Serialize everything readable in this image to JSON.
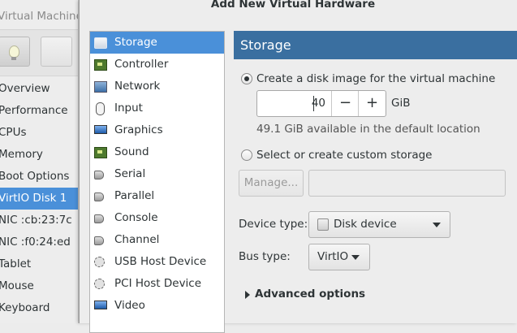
{
  "background_window": {
    "title": "Virtual Machine",
    "items": [
      {
        "label": "Overview"
      },
      {
        "label": "Performance"
      },
      {
        "label": "CPUs"
      },
      {
        "label": "Memory"
      },
      {
        "label": "Boot Options"
      },
      {
        "label": "VirtIO Disk 1",
        "selected": true
      },
      {
        "label": "NIC :cb:23:7c"
      },
      {
        "label": "NIC :f0:24:ed"
      },
      {
        "label": "Tablet"
      },
      {
        "label": "Mouse"
      },
      {
        "label": "Keyboard"
      }
    ]
  },
  "dialog": {
    "title": "Add New Virtual Hardware",
    "hardware_list": [
      {
        "label": "Storage",
        "icon": "disk-icon",
        "selected": true
      },
      {
        "label": "Controller",
        "icon": "chip-icon"
      },
      {
        "label": "Network",
        "icon": "network-icon"
      },
      {
        "label": "Input",
        "icon": "mouse-icon"
      },
      {
        "label": "Graphics",
        "icon": "monitor-icon"
      },
      {
        "label": "Sound",
        "icon": "sound-card-icon"
      },
      {
        "label": "Serial",
        "icon": "plug-icon"
      },
      {
        "label": "Parallel",
        "icon": "plug-icon"
      },
      {
        "label": "Console",
        "icon": "plug-icon"
      },
      {
        "label": "Channel",
        "icon": "plug-icon"
      },
      {
        "label": "USB Host Device",
        "icon": "usb-icon"
      },
      {
        "label": "PCI Host Device",
        "icon": "usb-icon"
      },
      {
        "label": "Video",
        "icon": "monitor-icon"
      }
    ],
    "storage": {
      "header": "Storage",
      "create_label": "Create a disk image for the virtual machine",
      "size_value": "40",
      "size_unit": "GiB",
      "available_text": "49.1 GiB available in the default location",
      "custom_label": "Select or create custom storage",
      "manage_label": "Manage...",
      "custom_path_value": "",
      "device_type_label": "Device type:",
      "device_type_value": "Disk device",
      "bus_type_label": "Bus type:",
      "bus_type_value": "VirtIO",
      "advanced_label": "Advanced options"
    }
  },
  "colors": {
    "selection": "#4a90d9",
    "header": "#3a6fa0"
  }
}
